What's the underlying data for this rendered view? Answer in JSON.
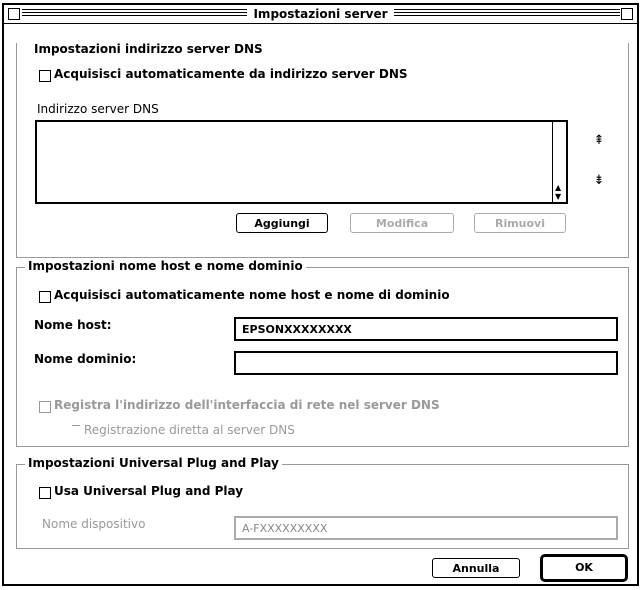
{
  "window": {
    "title": "Impostazioni server"
  },
  "dns_address": {
    "group_label": "Impostazioni indirizzo server DNS",
    "auto_checkbox_label": "Acquisisci automaticamente da indirizzo server DNS",
    "list_label": "Indirizzo server DNS",
    "move_up_label": "⇞",
    "move_down_label": "⇟",
    "add_button": "Aggiungi",
    "edit_button": "Modifica",
    "remove_button": "Rimuovi"
  },
  "hostname": {
    "group_label": "Impostazioni nome host e nome dominio",
    "auto_checkbox_label": "Acquisisci automaticamente nome host e nome di dominio",
    "host_label": "Nome host:",
    "host_value": "EPSONXXXXXXXX",
    "domain_label": "Nome dominio:",
    "domain_value": "",
    "register_label": "Registra l'indirizzo dell'interfaccia di rete nel server DNS",
    "register_sub_label": "Registrazione diretta al server DNS"
  },
  "upnp": {
    "group_label": "Impostazioni Universal Plug and Play",
    "enable_label": "Usa Universal Plug and Play",
    "device_name_label": "Nome dispositivo",
    "device_name_value": "A-FXXXXXXXXX"
  },
  "footer": {
    "cancel_button": "Annulla",
    "ok_button": "OK"
  }
}
